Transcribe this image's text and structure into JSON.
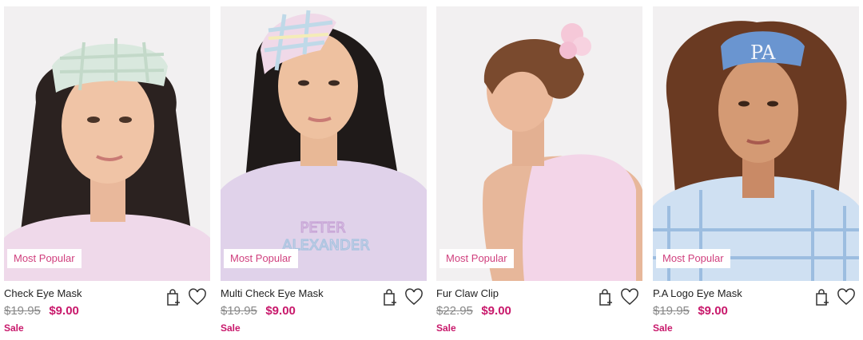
{
  "products": [
    {
      "name": "Check Eye Mask",
      "badge": "Most Popular",
      "was_price": "$19.95",
      "sale_price": "$9.00",
      "sale_label": "Sale"
    },
    {
      "name": "Multi Check Eye Mask",
      "badge": "Most Popular",
      "was_price": "$19.95",
      "sale_price": "$9.00",
      "sale_label": "Sale"
    },
    {
      "name": "Fur Claw Clip",
      "badge": "Most Popular",
      "was_price": "$22.95",
      "sale_price": "$9.00",
      "sale_label": "Sale"
    },
    {
      "name": "P.A Logo Eye Mask",
      "badge": "Most Popular",
      "was_price": "$19.95",
      "sale_price": "$9.00",
      "sale_label": "Sale"
    }
  ],
  "tee_print_lines": [
    "PETER",
    "ALEXANDER"
  ],
  "mask_logo": "PA",
  "icons": {
    "add_to_bag": "shopping-bag-plus-icon",
    "wishlist": "heart-icon"
  },
  "colors": {
    "badge_text": "#d0407e",
    "sale_price": "#c8186b",
    "was_price": "#888888",
    "image_bg": "#f1eff0"
  }
}
